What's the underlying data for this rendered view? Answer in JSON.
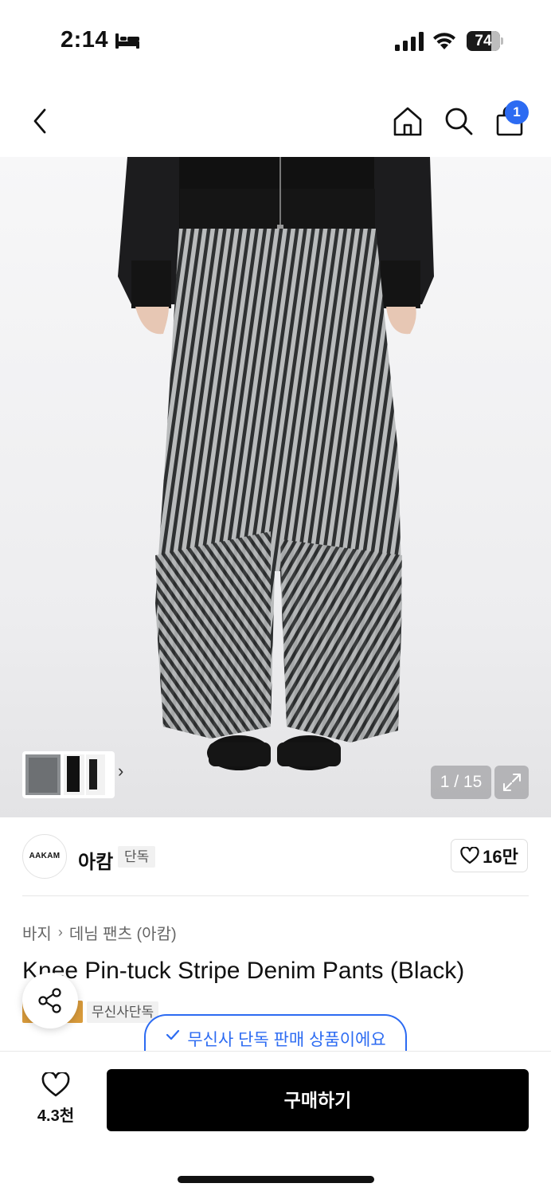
{
  "status_bar": {
    "time": "2:14",
    "battery": "74",
    "battery_level": 0.74
  },
  "nav": {
    "cart_badge": "1"
  },
  "gallery": {
    "page_counter": "1 / 15",
    "thumb_chevron": "›"
  },
  "brand": {
    "logo_text": "AAKAM",
    "name": "아캄",
    "exclusive_tag": "단독",
    "likes": "16만"
  },
  "product": {
    "breadcrumb": [
      "바지",
      "데님 팬츠 (아캄)"
    ],
    "breadcrumb_sep": "›",
    "title": "Knee Pin-tuck Stripe Denim Pants (Black)",
    "musinsa_tag": "무신사단독",
    "exclusive_notice": "무신사 단독 판매 상품이에요"
  },
  "bottom": {
    "wish_count": "4.3천",
    "buy_label": "구매하기"
  },
  "colors": {
    "accent": "#2c6bf2",
    "buy": "#000000",
    "gold": "#d99b3b"
  }
}
